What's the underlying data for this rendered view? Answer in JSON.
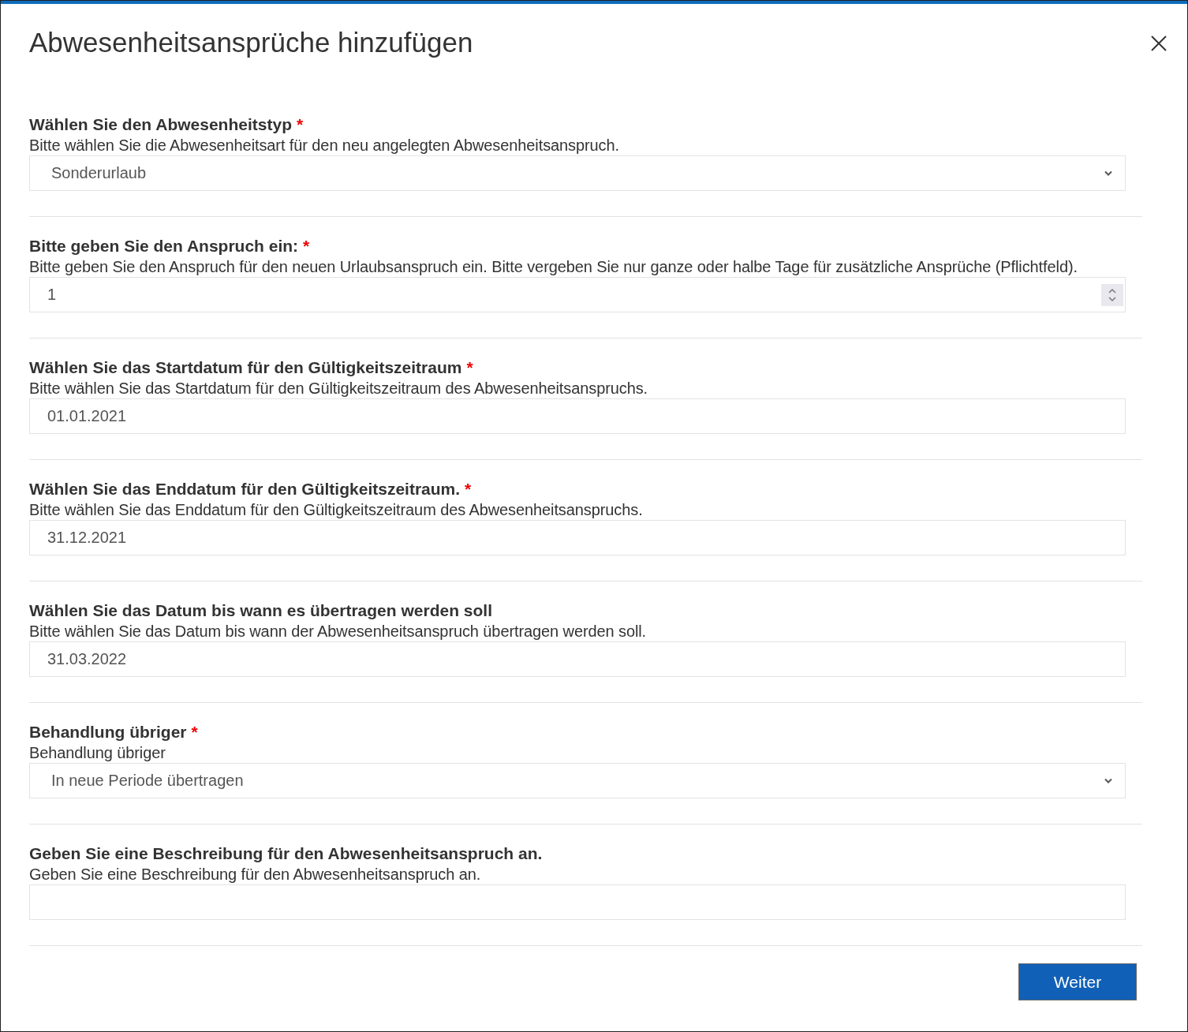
{
  "dialog": {
    "title": "Abwesenheitsansprüche hinzufügen"
  },
  "fields": [
    {
      "kind": "select",
      "label": "Wählen Sie den Abwesenheitstyp",
      "required_mark": "*",
      "description": "Bitte wählen Sie die Abwesenheitsart für den neu angelegten Abwesenheitsanspruch.",
      "value": "Sonderurlaub"
    },
    {
      "kind": "number",
      "label": "Bitte geben Sie den Anspruch ein:",
      "required_mark": "*",
      "description": "Bitte geben Sie den Anspruch für den neuen Urlaubsanspruch ein. Bitte vergeben Sie nur ganze oder halbe Tage für zusätzliche Ansprüche (Pflichtfeld).",
      "value": "1"
    },
    {
      "kind": "text",
      "label": "Wählen Sie das Startdatum für den Gültigkeitszeitraum",
      "required_mark": "*",
      "description": "Bitte wählen Sie das Startdatum für den Gültigkeitszeitraum des Abwesenheitsanspruchs.",
      "value": "01.01.2021"
    },
    {
      "kind": "text",
      "label": "Wählen Sie das Enddatum für den Gültigkeitszeitraum.",
      "required_mark": "*",
      "description": "Bitte wählen Sie das Enddatum für den Gültigkeitszeitraum des Abwesenheitsanspruchs.",
      "value": "31.12.2021"
    },
    {
      "kind": "text",
      "label": "Wählen Sie das Datum bis wann es übertragen werden soll",
      "description": "Bitte wählen Sie das Datum bis wann der Abwesenheitsanspruch übertragen werden soll.",
      "value": "31.03.2022"
    },
    {
      "kind": "select",
      "label": "Behandlung übriger",
      "required_mark": "*",
      "description": "Behandlung übriger",
      "value": "In neue Periode übertragen"
    },
    {
      "kind": "text",
      "label": "Geben Sie eine Beschreibung für den Abwesenheitsanspruch an.",
      "description": "Geben Sie eine Beschreibung für den Abwesenheitsanspruch an."
    }
  ],
  "buttons": [
    {
      "label": "Weiter"
    }
  ]
}
